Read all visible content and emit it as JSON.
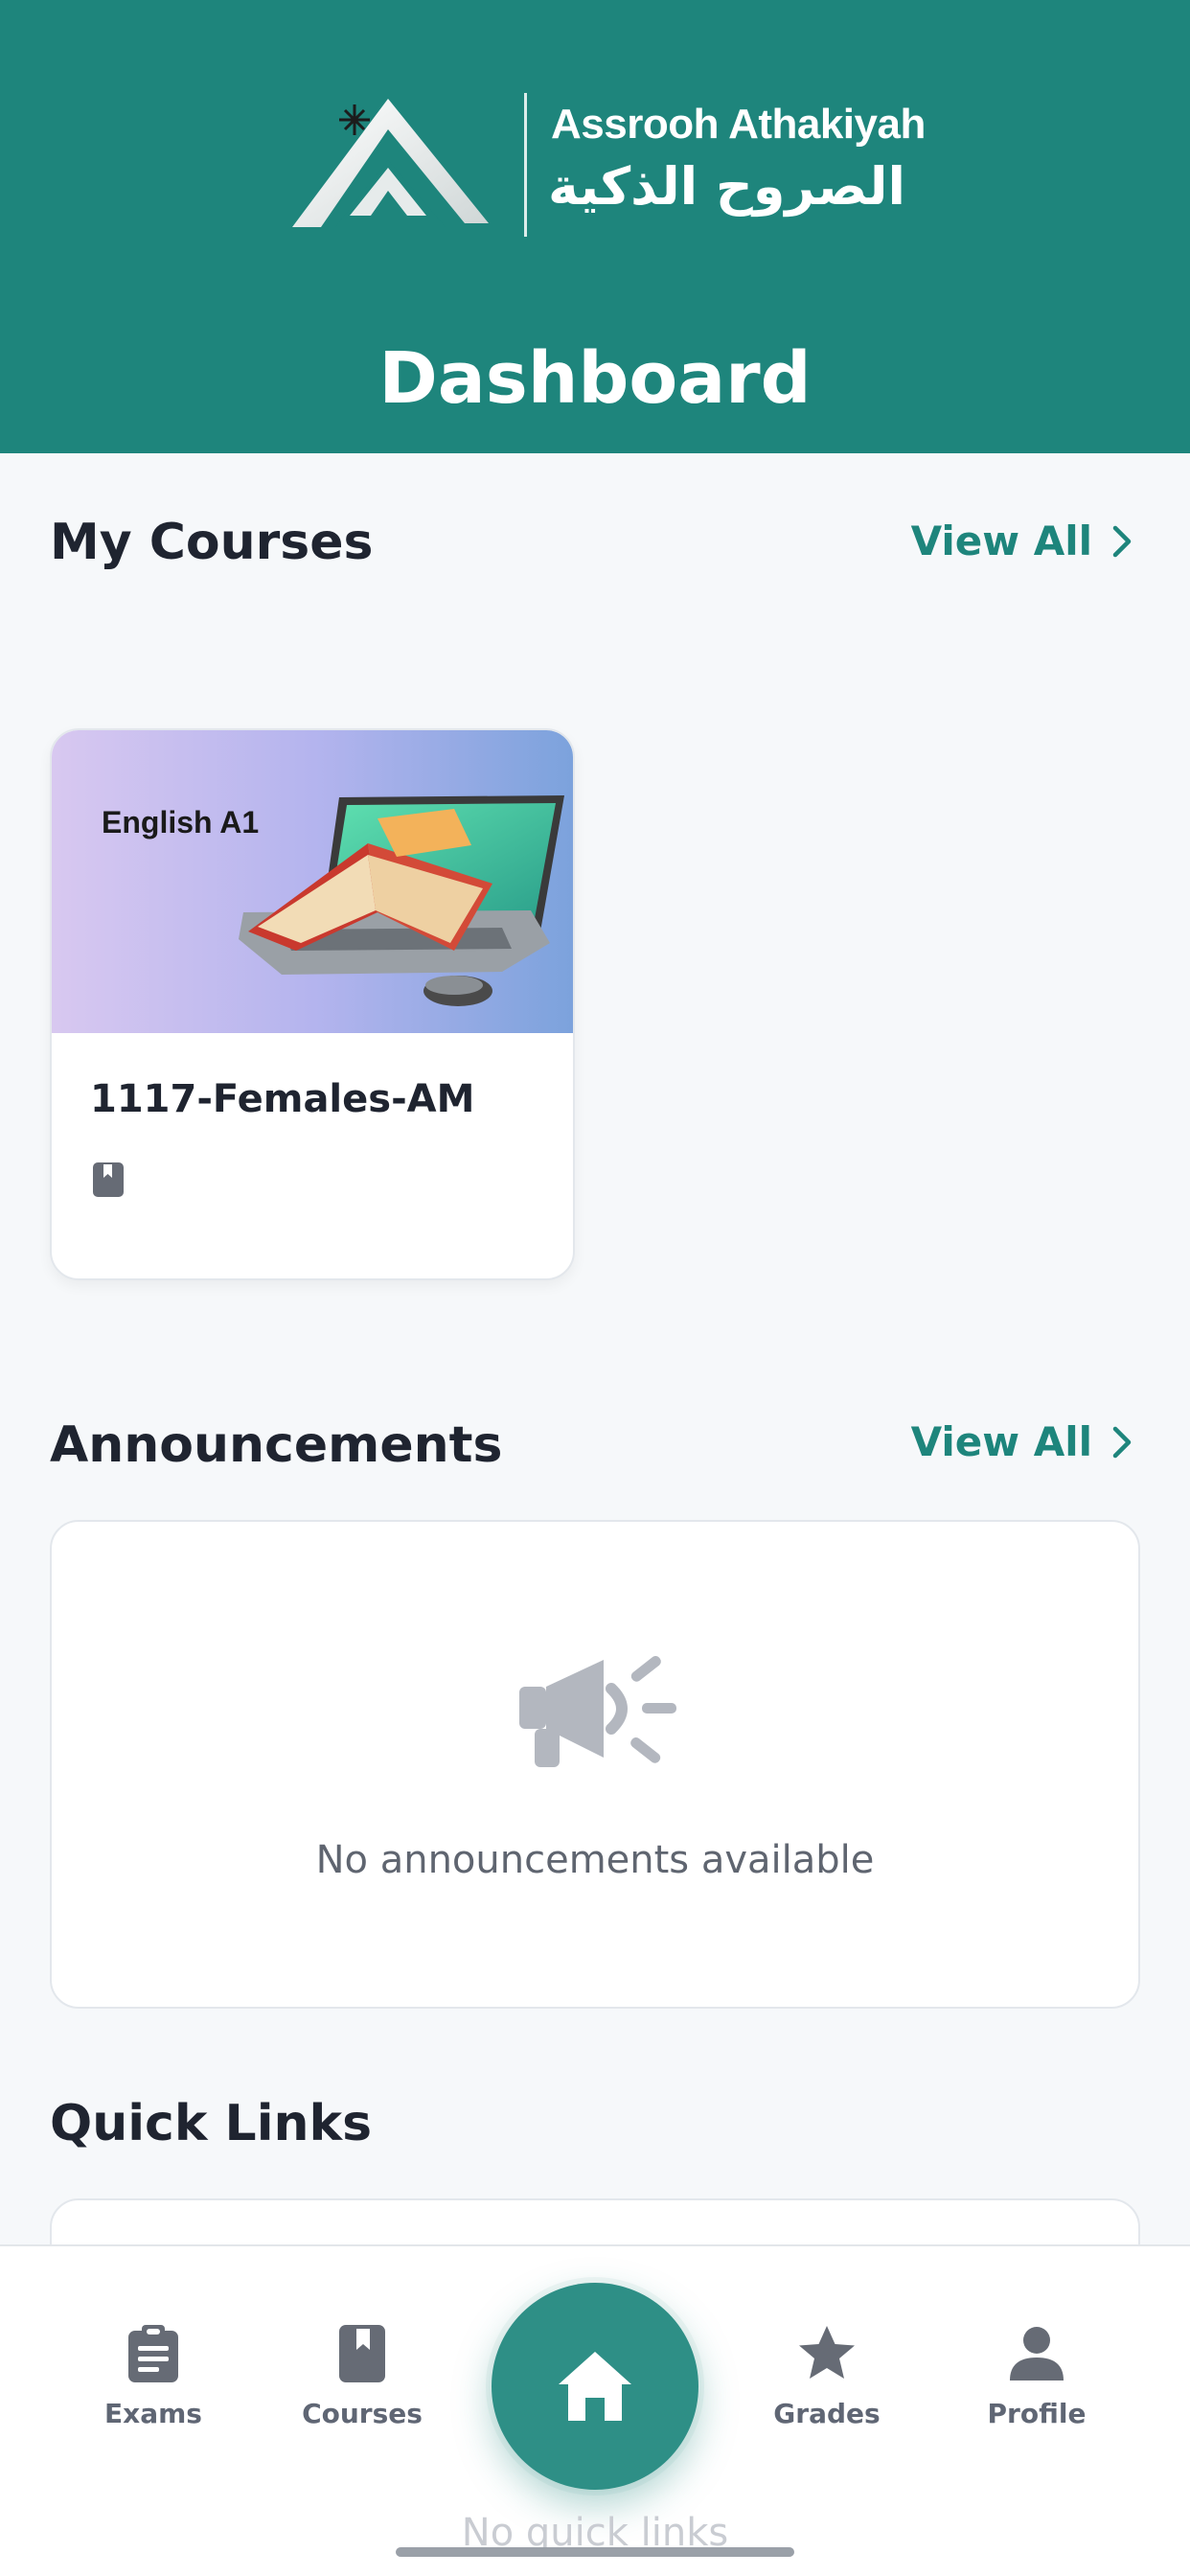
{
  "header": {
    "brand_en": "Assrooh Athakiyah",
    "brand_ar": "الصروح الذكية",
    "title": "Dashboard",
    "color": "#1e857c"
  },
  "courses": {
    "title": "My Courses",
    "view_all": "View All",
    "items": [
      {
        "image_label": "English A1",
        "name": "1117-Females-AM",
        "icon": "book-icon"
      }
    ]
  },
  "announcements": {
    "title": "Announcements",
    "view_all": "View All",
    "empty_text": "No announcements available",
    "icon": "megaphone-icon"
  },
  "quick_links": {
    "title": "Quick Links",
    "empty_text": "No quick links"
  },
  "tabbar": {
    "tabs": [
      {
        "label": "Exams",
        "icon": "clipboard-icon"
      },
      {
        "label": "Courses",
        "icon": "book-icon"
      },
      {
        "label": "Home",
        "icon": "home-icon",
        "active": true
      },
      {
        "label": "Grades",
        "icon": "star-icon"
      },
      {
        "label": "Profile",
        "icon": "person-icon"
      }
    ]
  },
  "colors": {
    "accent": "#1e857c",
    "background": "#f6f8fa",
    "text": "#1f2430",
    "muted": "#5f6674"
  }
}
